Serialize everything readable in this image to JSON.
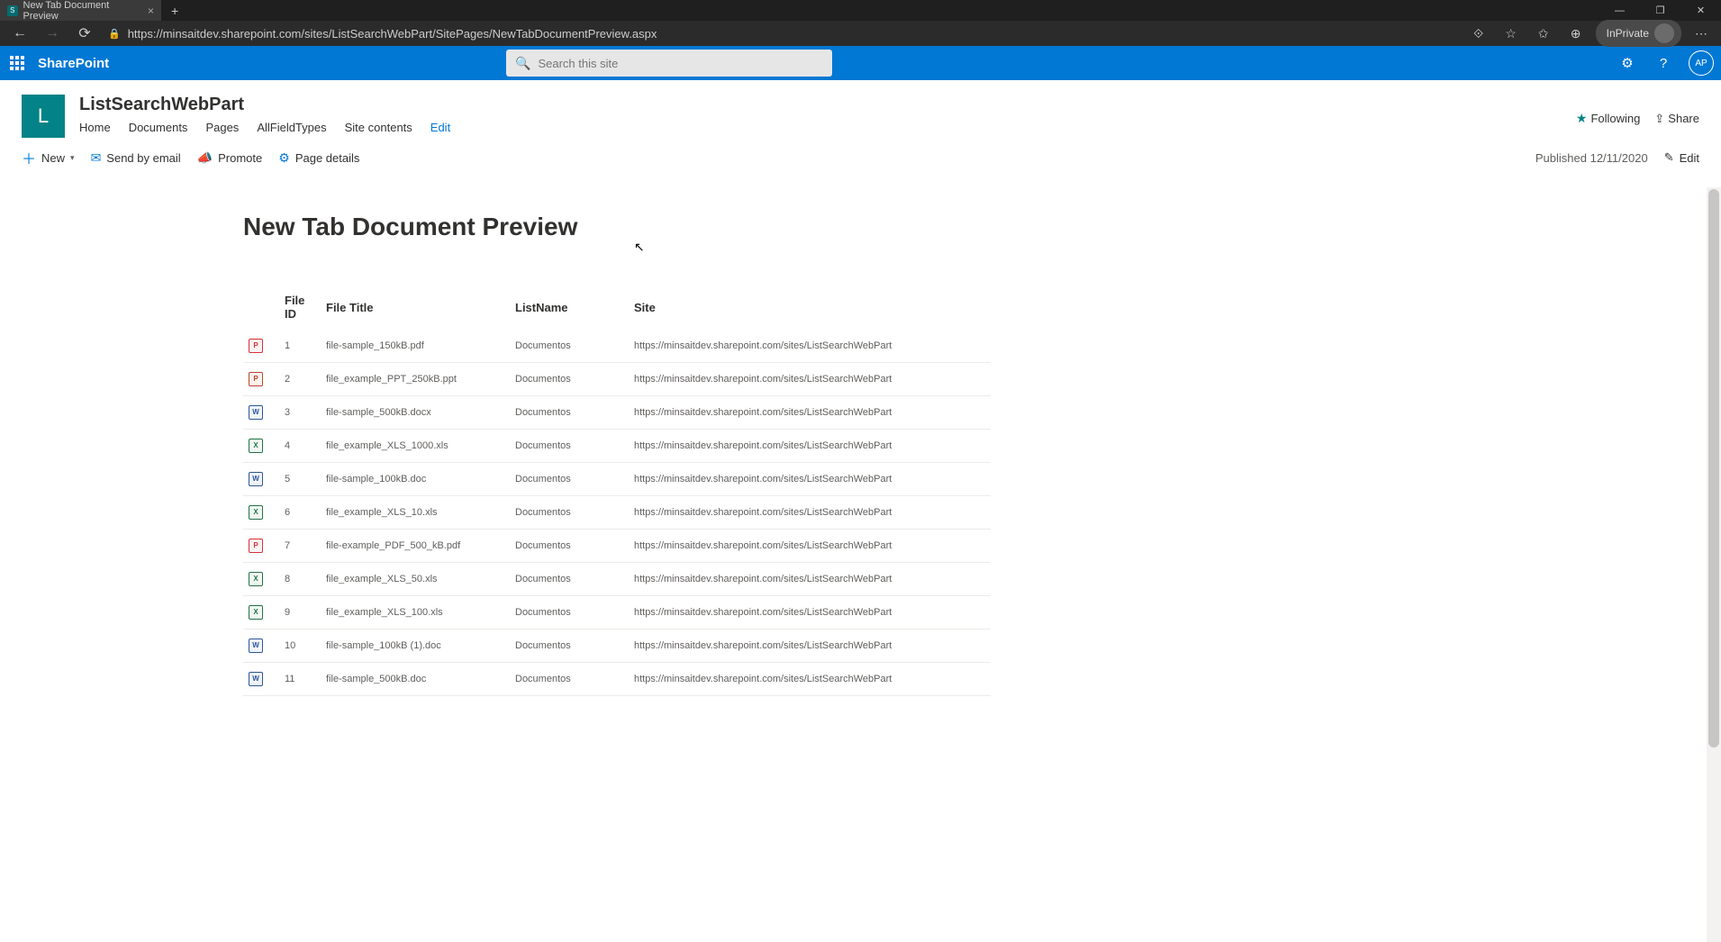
{
  "browser": {
    "tab_title": "New Tab Document Preview",
    "url": "https://minsaitdev.sharepoint.com/sites/ListSearchWebPart/SitePages/NewTabDocumentPreview.aspx",
    "inprivate_label": "InPrivate"
  },
  "suite": {
    "brand": "SharePoint",
    "search_placeholder": "Search this site",
    "avatar_initials": "AP"
  },
  "site": {
    "logo_letter": "L",
    "title": "ListSearchWebPart",
    "nav": {
      "home": "Home",
      "documents": "Documents",
      "pages": "Pages",
      "allfields": "AllFieldTypes",
      "contents": "Site contents",
      "edit": "Edit"
    },
    "follow": "Following",
    "share": "Share"
  },
  "cmd": {
    "new": "New",
    "send": "Send by email",
    "promote": "Promote",
    "details": "Page details",
    "published": "Published 12/11/2020",
    "edit": "Edit"
  },
  "page": {
    "title": "New Tab Document Preview"
  },
  "table": {
    "headers": {
      "id": "File ID",
      "title": "File Title",
      "list": "ListName",
      "site": "Site"
    },
    "rows": [
      {
        "id": "1",
        "type": "pdf",
        "title": "file-sample_150kB.pdf",
        "list": "Documentos",
        "site": "https://minsaitdev.sharepoint.com/sites/ListSearchWebPart"
      },
      {
        "id": "2",
        "type": "ppt",
        "title": "file_example_PPT_250kB.ppt",
        "list": "Documentos",
        "site": "https://minsaitdev.sharepoint.com/sites/ListSearchWebPart"
      },
      {
        "id": "3",
        "type": "doc",
        "title": "file-sample_500kB.docx",
        "list": "Documentos",
        "site": "https://minsaitdev.sharepoint.com/sites/ListSearchWebPart"
      },
      {
        "id": "4",
        "type": "xls",
        "title": "file_example_XLS_1000.xls",
        "list": "Documentos",
        "site": "https://minsaitdev.sharepoint.com/sites/ListSearchWebPart"
      },
      {
        "id": "5",
        "type": "doc",
        "title": "file-sample_100kB.doc",
        "list": "Documentos",
        "site": "https://minsaitdev.sharepoint.com/sites/ListSearchWebPart"
      },
      {
        "id": "6",
        "type": "xls",
        "title": "file_example_XLS_10.xls",
        "list": "Documentos",
        "site": "https://minsaitdev.sharepoint.com/sites/ListSearchWebPart"
      },
      {
        "id": "7",
        "type": "pdf",
        "title": "file-example_PDF_500_kB.pdf",
        "list": "Documentos",
        "site": "https://minsaitdev.sharepoint.com/sites/ListSearchWebPart"
      },
      {
        "id": "8",
        "type": "xls",
        "title": "file_example_XLS_50.xls",
        "list": "Documentos",
        "site": "https://minsaitdev.sharepoint.com/sites/ListSearchWebPart"
      },
      {
        "id": "9",
        "type": "xls",
        "title": "file_example_XLS_100.xls",
        "list": "Documentos",
        "site": "https://minsaitdev.sharepoint.com/sites/ListSearchWebPart"
      },
      {
        "id": "10",
        "type": "doc",
        "title": "file-sample_100kB (1).doc",
        "list": "Documentos",
        "site": "https://minsaitdev.sharepoint.com/sites/ListSearchWebPart"
      },
      {
        "id": "11",
        "type": "doc",
        "title": "file-sample_500kB.doc",
        "list": "Documentos",
        "site": "https://minsaitdev.sharepoint.com/sites/ListSearchWebPart"
      }
    ]
  }
}
